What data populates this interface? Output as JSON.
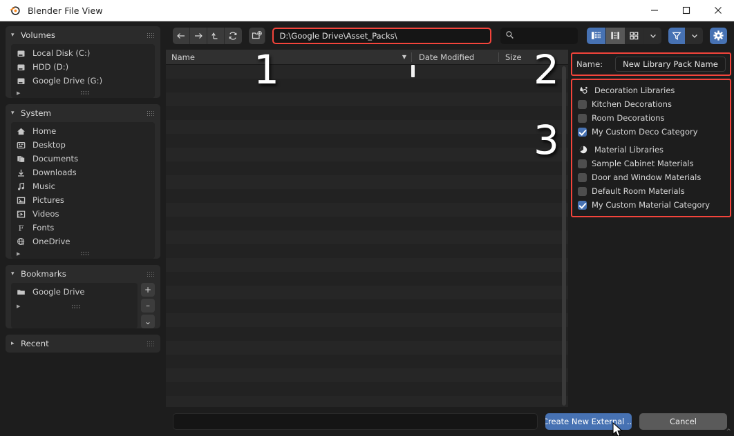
{
  "window": {
    "title": "Blender File View",
    "app_icon": "blender-logo-icon",
    "minimize_label": "–",
    "maximize_label": "☐",
    "close_label": "✕"
  },
  "sidebar": {
    "panels": [
      {
        "name": "volumes",
        "title": "Volumes",
        "expanded": true,
        "items": [
          {
            "label": "Local Disk (C:)",
            "icon": "disk-drive-icon"
          },
          {
            "label": "HDD (D:)",
            "icon": "disk-drive-icon"
          },
          {
            "label": "Google Drive (G:)",
            "icon": "disk-drive-icon"
          }
        ]
      },
      {
        "name": "system",
        "title": "System",
        "expanded": true,
        "items": [
          {
            "label": "Home",
            "icon": "home-icon"
          },
          {
            "label": "Desktop",
            "icon": "desktop-icon"
          },
          {
            "label": "Documents",
            "icon": "documents-icon"
          },
          {
            "label": "Downloads",
            "icon": "download-arrow-icon"
          },
          {
            "label": "Music",
            "icon": "music-note-icon"
          },
          {
            "label": "Pictures",
            "icon": "image-icon"
          },
          {
            "label": "Videos",
            "icon": "film-strip-icon"
          },
          {
            "label": "Fonts",
            "icon": "font-f-icon"
          },
          {
            "label": "OneDrive",
            "icon": "globe-cloud-icon"
          }
        ]
      },
      {
        "name": "bookmarks",
        "title": "Bookmarks",
        "expanded": true,
        "items": [
          {
            "label": "Google Drive",
            "icon": "folder-icon"
          }
        ],
        "buttons": [
          {
            "name": "add-bookmark-button",
            "label": "+"
          },
          {
            "name": "remove-bookmark-button",
            "label": "–"
          },
          {
            "name": "bookmark-options-button",
            "label": "⌄"
          }
        ]
      },
      {
        "name": "recent",
        "title": "Recent",
        "expanded": false,
        "items": []
      }
    ]
  },
  "toolbar": {
    "nav": [
      {
        "name": "back-button",
        "icon": "arrow-left-icon"
      },
      {
        "name": "forward-button",
        "icon": "arrow-right-icon"
      },
      {
        "name": "parent-directory-button",
        "icon": "arrow-up-icon"
      },
      {
        "name": "refresh-button",
        "icon": "refresh-icon"
      }
    ],
    "new_folder": {
      "name": "new-folder-button",
      "icon": "new-folder-icon"
    },
    "path": {
      "value": "D:\\Google Drive\\Asset_Packs\\",
      "placeholder": "Directory path",
      "highlight_color": "#f4443b"
    },
    "search": {
      "value": "",
      "placeholder": "",
      "icon": "search-icon"
    },
    "view_modes": [
      {
        "name": "vertical-list-view-button",
        "icon": "list-view-icon",
        "active": true
      },
      {
        "name": "horizontal-list-view-button",
        "icon": "detail-view-icon",
        "active": false
      },
      {
        "name": "thumbnail-view-button",
        "icon": "grid-view-icon",
        "active": false
      },
      {
        "name": "display-options-dropdown",
        "icon": "chevron-down-icon",
        "active": false
      }
    ],
    "filter": [
      {
        "name": "filter-toggle-button",
        "icon": "funnel-icon",
        "active": true
      },
      {
        "name": "filter-options-dropdown",
        "icon": "chevron-down-icon",
        "active": false
      }
    ],
    "settings": {
      "name": "file-settings-button",
      "icon": "gear-icon",
      "accent": "#4772b3"
    }
  },
  "file_list": {
    "columns": [
      {
        "name": "name-column",
        "label": "Name",
        "sort": "descending"
      },
      {
        "name": "date-column",
        "label": "Date Modified"
      },
      {
        "name": "size-column",
        "label": "Size"
      }
    ],
    "rows": [],
    "empty": true,
    "row_count_visible": 25
  },
  "properties": {
    "name_field": {
      "label": "Name:",
      "value": "New Library Pack Name",
      "placeholder": "New Library Pack Name"
    },
    "groups": [
      {
        "name": "decoration-libraries",
        "header": "Decoration Libraries",
        "header_icon": "decoration-brush-icon",
        "items": [
          {
            "label": "Kitchen Decorations",
            "checked": false
          },
          {
            "label": "Room Decorations",
            "checked": false
          },
          {
            "label": "My Custom Deco Category",
            "checked": true
          }
        ]
      },
      {
        "name": "material-libraries",
        "header": "Material Libraries",
        "header_icon": "material-sphere-icon",
        "items": [
          {
            "label": "Sample Cabinet Materials",
            "checked": false
          },
          {
            "label": "Door and Window Materials",
            "checked": false
          },
          {
            "label": "Default Room Materials",
            "checked": false
          },
          {
            "label": "My Custom Material Category",
            "checked": true
          }
        ]
      }
    ],
    "highlight_color": "#f4443b"
  },
  "bottom_bar": {
    "filename": {
      "value": "",
      "placeholder": ""
    },
    "confirm_button": {
      "label": "Create New External ...",
      "accent": "#4772b3"
    },
    "cancel_button": {
      "label": "Cancel"
    }
  },
  "overlays": [
    {
      "name": "step-number-1",
      "label": "1"
    },
    {
      "name": "step-number-2",
      "label": "2"
    },
    {
      "name": "step-number-3",
      "label": "3"
    }
  ]
}
